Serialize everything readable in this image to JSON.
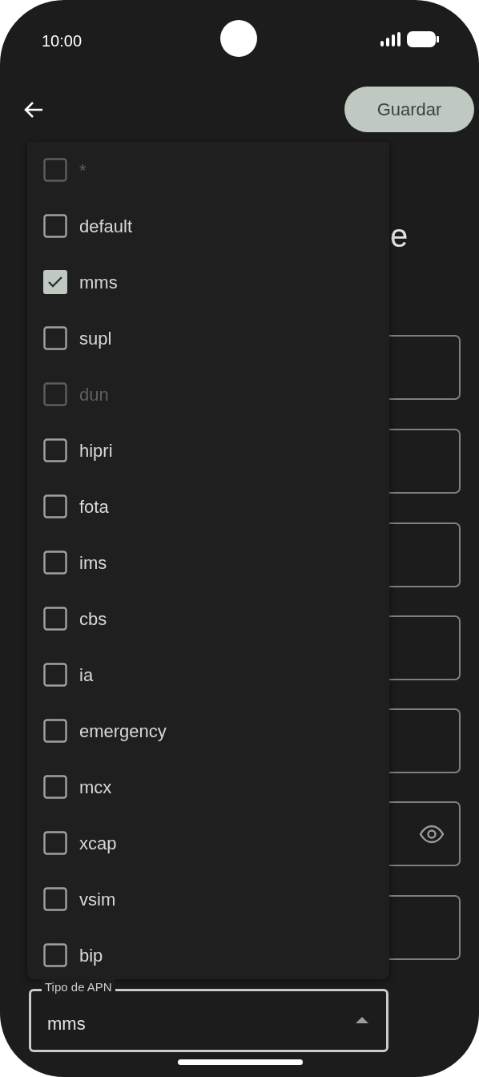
{
  "status_bar": {
    "time": "10:00"
  },
  "toolbar": {
    "save_button": "Guardar"
  },
  "heading": "e",
  "background_fields": [
    {
      "kind": "text"
    },
    {
      "kind": "text"
    },
    {
      "kind": "text"
    },
    {
      "kind": "text"
    },
    {
      "kind": "text"
    },
    {
      "kind": "password"
    },
    {
      "kind": "text"
    }
  ],
  "menu": {
    "items": [
      {
        "label": "*",
        "checked": false,
        "disabled": true
      },
      {
        "label": "default",
        "checked": false,
        "disabled": false
      },
      {
        "label": "mms",
        "checked": true,
        "disabled": false
      },
      {
        "label": "supl",
        "checked": false,
        "disabled": false
      },
      {
        "label": "dun",
        "checked": false,
        "disabled": true
      },
      {
        "label": "hipri",
        "checked": false,
        "disabled": false
      },
      {
        "label": "fota",
        "checked": false,
        "disabled": false
      },
      {
        "label": "ims",
        "checked": false,
        "disabled": false
      },
      {
        "label": "cbs",
        "checked": false,
        "disabled": false
      },
      {
        "label": "ia",
        "checked": false,
        "disabled": false
      },
      {
        "label": "emergency",
        "checked": false,
        "disabled": false
      },
      {
        "label": "mcx",
        "checked": false,
        "disabled": false
      },
      {
        "label": "xcap",
        "checked": false,
        "disabled": false
      },
      {
        "label": "vsim",
        "checked": false,
        "disabled": false
      },
      {
        "label": "bip",
        "checked": false,
        "disabled": false
      }
    ]
  },
  "apn_type_field": {
    "label": "Tipo de APN",
    "value": "mms",
    "expanded": true
  }
}
